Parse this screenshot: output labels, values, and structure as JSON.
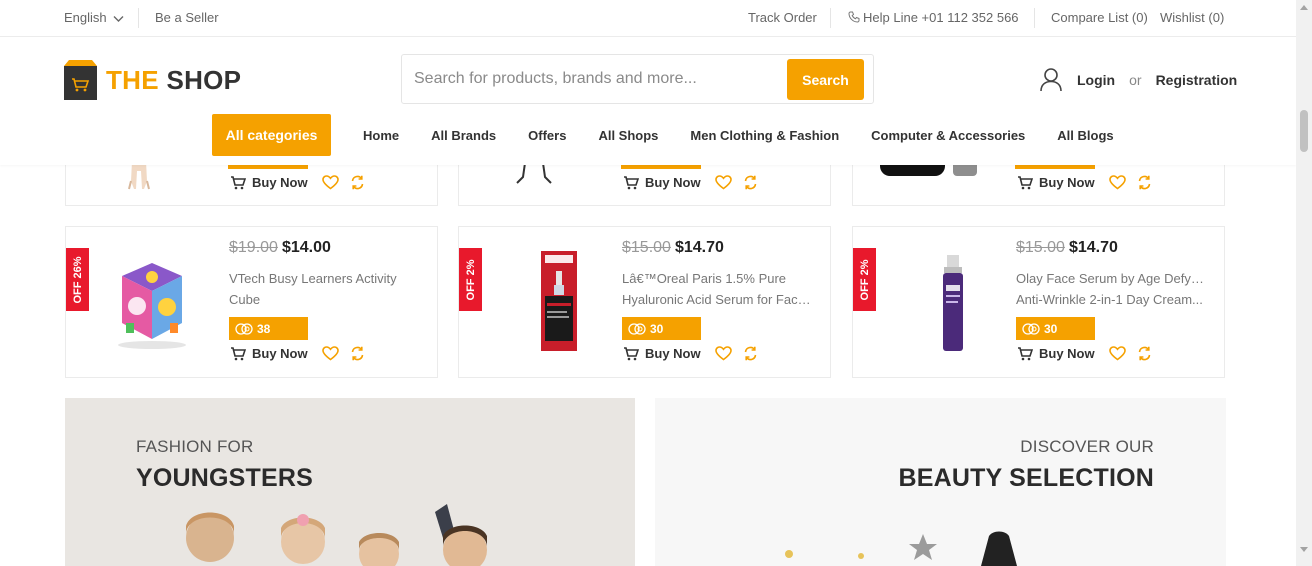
{
  "topbar": {
    "language": "English",
    "seller": "Be a Seller",
    "track_order": "Track Order",
    "help_line": "Help Line +01 112 352 566",
    "compare": "Compare List (0)",
    "wishlist": "Wishlist (0)"
  },
  "header": {
    "logo_part1": "THE",
    "logo_part2": "SHOP",
    "search_placeholder": "Search for products, brands and more...",
    "search_button": "Search",
    "login": "Login",
    "or": "or",
    "registration": "Registration"
  },
  "nav": {
    "all_categories": "All categories",
    "items": [
      "Home",
      "All Brands",
      "Offers",
      "All Shops",
      "Men Clothing & Fashion",
      "Computer & Accessories",
      "All Blogs"
    ]
  },
  "partial_row": {
    "buy_label": "Buy Now"
  },
  "products": [
    {
      "badge": "OFF 26%",
      "old_price": "$19.00",
      "new_price": "$14.00",
      "name_line1": "VTech Busy Learners Activity",
      "name_line2": "Cube",
      "points": "38",
      "buy_label": "Buy Now"
    },
    {
      "badge": "OFF 2%",
      "old_price": "$15.00",
      "new_price": "$14.70",
      "name_line1": "Lâ€™Oreal Paris 1.5% Pure",
      "name_line2": "Hyaluronic Acid Serum for Face...",
      "points": "30",
      "buy_label": "Buy Now"
    },
    {
      "badge": "OFF 2%",
      "old_price": "$15.00",
      "new_price": "$14.70",
      "name_line1": "Olay Face Serum by Age Defying",
      "name_line2": "Anti-Wrinkle 2-in-1 Day Cream...",
      "points": "30",
      "buy_label": "Buy Now"
    }
  ],
  "banners": [
    {
      "subtitle": "FASHION FOR",
      "title": "YOUNGSTERS"
    },
    {
      "subtitle": "DISCOVER OUR",
      "title": "BEAUTY SELECTION"
    }
  ],
  "colors": {
    "accent": "#f5a100",
    "badge": "#e8192c"
  }
}
